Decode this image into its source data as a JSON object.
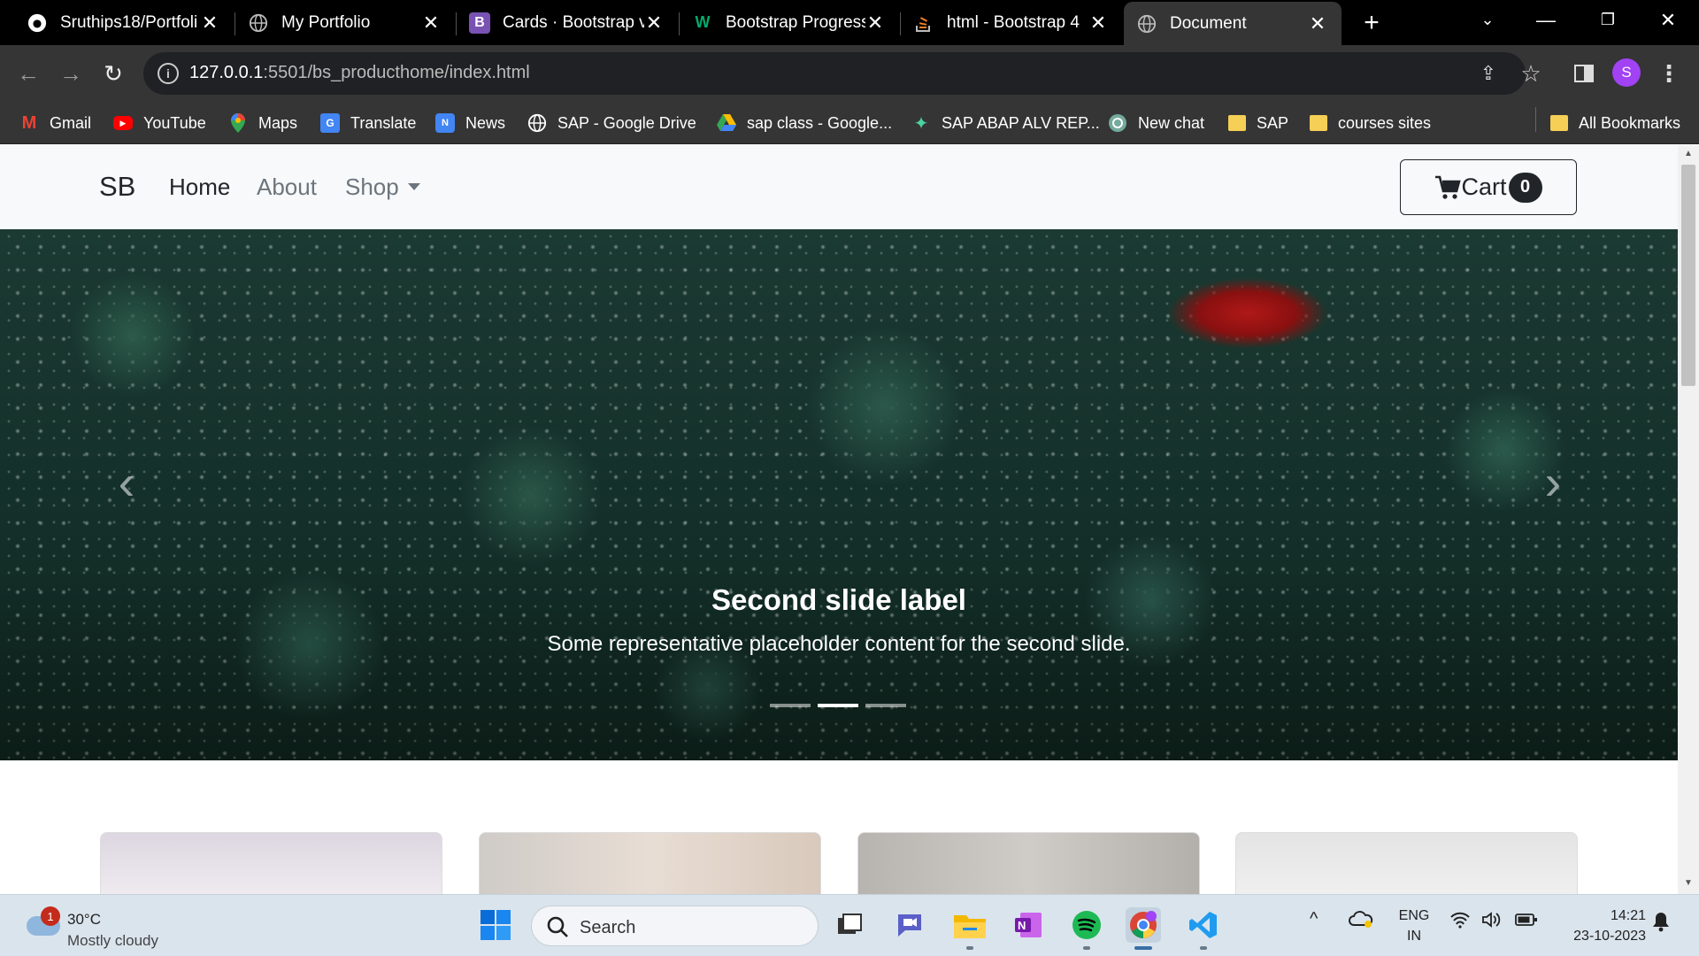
{
  "browser": {
    "tabs": [
      {
        "label": "Sruthips18/Portfoli",
        "icon": "github-icon"
      },
      {
        "label": "My Portfolio",
        "icon": "globe-icon"
      },
      {
        "label": "Cards · Bootstrap v",
        "icon": "bootstrap-icon"
      },
      {
        "label": "Bootstrap Progress",
        "icon": "w3schools-icon"
      },
      {
        "label": "html - Bootstrap 4",
        "icon": "stackoverflow-icon"
      },
      {
        "label": "Document",
        "icon": "globe-icon",
        "active": true
      }
    ],
    "url_host": "127.0.0.1",
    "url_path": ":5501/bs_producthome/index.html",
    "profile_initial": "S",
    "bookmarks": [
      {
        "label": "Gmail",
        "icon": "gmail-icon"
      },
      {
        "label": "YouTube",
        "icon": "youtube-icon"
      },
      {
        "label": "Maps",
        "icon": "maps-icon"
      },
      {
        "label": "Translate",
        "icon": "translate-icon"
      },
      {
        "label": "News",
        "icon": "news-icon"
      },
      {
        "label": "SAP - Google Drive",
        "icon": "globe-icon"
      },
      {
        "label": "sap class - Google...",
        "icon": "drive-icon"
      },
      {
        "label": "SAP ABAP ALV REP...",
        "icon": "sparkle-icon"
      },
      {
        "label": "New chat",
        "icon": "openai-icon"
      },
      {
        "label": "SAP",
        "icon": "folder-icon"
      },
      {
        "label": "courses sites",
        "icon": "folder-icon"
      }
    ],
    "all_bookmarks": "All Bookmarks"
  },
  "site": {
    "brand": "SB",
    "nav": {
      "home": "Home",
      "about": "About",
      "shop": "Shop"
    },
    "cart_label": "Cart",
    "cart_count": "0",
    "carousel": {
      "title": "Second slide label",
      "text": "Some representative placeholder content for the second slide.",
      "slides_total": 3,
      "active_index": 1
    }
  },
  "taskbar": {
    "weather_temp": "30°C",
    "weather_desc": "Mostly cloudy",
    "weather_badge": "1",
    "search_placeholder": "Search",
    "lang_line1": "ENG",
    "lang_line2": "IN",
    "time": "14:21",
    "date": "23-10-2023"
  },
  "colors": {
    "accent": "#a142f4",
    "brand_dark": "#212529"
  }
}
